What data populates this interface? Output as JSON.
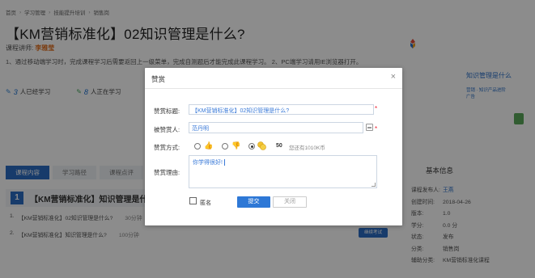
{
  "breadcrumb": [
    "首页",
    "学习管理",
    "技能提升培训",
    "销售岗"
  ],
  "course": {
    "title": "【KM营销标准化】02知识管理是什么?",
    "lecturer_label": "课程讲师:",
    "lecturer_name": "李雅莹",
    "notice": "1、通过移动端学习时，完成课程学习后需要返回上一级菜单，完成自测题后才能完成此课程学习。 2、PC端学习请用IE浏览器打开。",
    "learned_count": "3",
    "learned_label": "人已经学习",
    "learning_count": "8",
    "learning_label": "人正在学习"
  },
  "promo": {
    "line1": "知识管理是什么",
    "line2": "营销 · 知识产品进阶广告"
  },
  "tabs": [
    "课程内容",
    "学习路径",
    "课程点评"
  ],
  "section": {
    "number": "1",
    "title": "【KM营销标准化】知识管理是什么?"
  },
  "lessons": [
    {
      "index": "1.",
      "title": "【KM营销标准化】02知识管理是什么?",
      "duration": "30分钟"
    },
    {
      "index": "2.",
      "title": "【KM营销标准化】知识管理是什么?",
      "duration": "100分钟"
    }
  ],
  "study_button": "继续考试",
  "info": {
    "title": "基本信息",
    "rows": [
      {
        "k": "课程发布人:",
        "v": "王燕",
        "link": true
      },
      {
        "k": "创建时间:",
        "v": "2018-04-26",
        "link": false
      },
      {
        "k": "版本:",
        "v": "1.0",
        "link": false
      },
      {
        "k": "学分:",
        "v": "0.0 分",
        "link": false
      },
      {
        "k": "状态:",
        "v": "发布",
        "link": false
      },
      {
        "k": "分类:",
        "v": "销售岗",
        "link": false
      },
      {
        "k": "辅助分类:",
        "v": "KM营销标准化课程",
        "link": false
      }
    ]
  },
  "modal": {
    "title": "赞赏",
    "close_symbol": "×",
    "title_label": "赞赏标题:",
    "title_value": "【KM营销标准化】02知识管理是什么?",
    "recipient_label": "被赞赏人:",
    "recipient_value": "范丹明",
    "method_label": "赞赏方式:",
    "amount": "50",
    "balance": "您还有1010K币",
    "reason_label": "赞赏理由:",
    "reason_value": "你学得很好!",
    "anonymous_label": "匿名",
    "submit_label": "提交",
    "close_label": "关闭"
  }
}
